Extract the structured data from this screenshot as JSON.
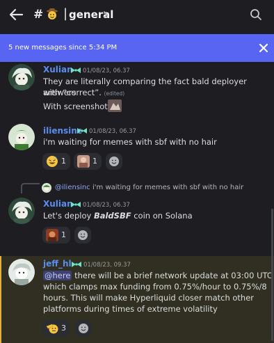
{
  "header": {
    "hash": "#",
    "separator": "|",
    "channel_name": "general",
    "icons": {
      "back": "arrow-left-icon",
      "emoji": "cowboy-emoji-icon",
      "chevron": "chevron-right-icon",
      "search": "search-icon"
    }
  },
  "banner": {
    "text": "5 new messages since 5:34 PM",
    "close_icon": "close-icon",
    "color": "#5865f2"
  },
  "messages": [
    {
      "author": "Xulian",
      "author_color": "#5b8df0",
      "timestamp": "01/08/23, 06.37",
      "lines": [
        "They are literally comparing the fact bald deployer answers",
        "with “correct”.",
        "With screenshots"
      ],
      "edited": "(edited)"
    },
    {
      "author": "iliensinc",
      "author_color": "#5b8df0",
      "timestamp": "01/08/23, 06.37",
      "text": "i'm waiting for memes with sbf with no hair",
      "reactions": [
        {
          "emoji": "grinning-sweat-face",
          "count": "1"
        },
        {
          "emoji": "custom-image-emoji",
          "count": "1"
        }
      ]
    },
    {
      "reply": {
        "author": "@iliensinc",
        "text": "i'm waiting for memes with sbf with no hair"
      },
      "author": "Xulian",
      "author_color": "#5b8df0",
      "timestamp": "01/08/23, 06.37",
      "text_before": "Let's deploy ",
      "text_bold": "BaldSBF",
      "text_after": " coin on Solana",
      "reactions": [
        {
          "emoji": "custom-image-emoji",
          "count": "1"
        }
      ]
    },
    {
      "author": "jeff_hl",
      "author_color": "#5b8df0",
      "timestamp": "01/08/23, 09.37",
      "mention": "@here",
      "lines": [
        " there will be a brief network update at 03:00 UTC",
        "which clamps max funding from 0.75%/hour to 0.75%/8",
        "hours. This will make Hyperliquid closer match other",
        "platforms during times of extreme volatility"
      ],
      "reactions": [
        {
          "emoji": "saluting-face",
          "count": "3"
        }
      ]
    }
  ]
}
